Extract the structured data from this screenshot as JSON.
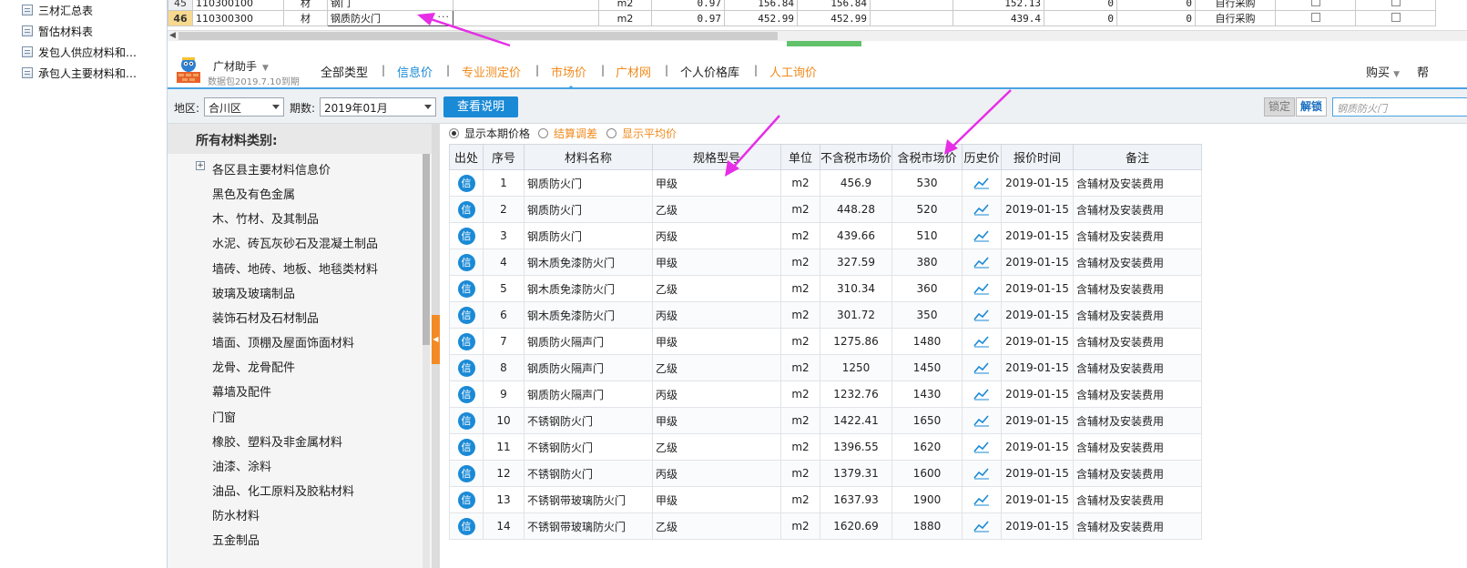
{
  "left_tree": {
    "items": [
      "三材汇总表",
      "暂估材料表",
      "发包人供应材料和…",
      "承包人主要材料和…"
    ]
  },
  "top_grid": {
    "rows": [
      {
        "num": "45",
        "code": "110300100",
        "type": "材",
        "name": "钢门",
        "unit": "m2",
        "coef": "0.97",
        "p1": "156.84",
        "p2": "156.84",
        "p3": "152.13",
        "v1": "0",
        "v2": "0",
        "purchase": "自行采购"
      },
      {
        "num": "46",
        "code": "110300300",
        "type": "材",
        "name": "钢质防火门",
        "unit": "m2",
        "coef": "0.97",
        "p1": "452.99",
        "p2": "452.99",
        "p3": "439.4",
        "v1": "0",
        "v2": "0",
        "purchase": "自行采购"
      }
    ],
    "ellipsis": "···"
  },
  "toolbar": {
    "brand": "广材助手",
    "brand_sub": "数据包2019.7.10到期",
    "tabs": [
      "全部类型",
      "信息价",
      "专业测定价",
      "市场价",
      "广材网",
      "个人价格库",
      "人工询价"
    ],
    "active_tab": "信息价",
    "buy": "购买",
    "help": "帮"
  },
  "filter": {
    "region_label": "地区:",
    "region_value": "合川区",
    "period_label": "期数:",
    "period_value": "2019年01月",
    "explain_button": "查看说明",
    "lock_button": "锁定",
    "unlock_button": "解锁",
    "search_value": "钢质防火门"
  },
  "categories": {
    "header": "所有材料类别:",
    "expander": "+",
    "items": [
      "各区县主要材料信息价",
      "黑色及有色金属",
      "木、竹材、及其制品",
      "水泥、砖瓦灰砂石及混凝土制品",
      "墙砖、地砖、地板、地毯类材料",
      "玻璃及玻璃制品",
      "装饰石材及石材制品",
      "墙面、顶棚及屋面饰面材料",
      "龙骨、龙骨配件",
      "幕墙及配件",
      "门窗",
      "橡胶、塑料及非金属材料",
      "油漆、涂料",
      "油品、化工原料及胶粘材料",
      "防水材料",
      "五金制品"
    ]
  },
  "options": {
    "show_current": "显示本期价格",
    "settlement": "结算调差",
    "show_average": "显示平均价"
  },
  "price_table": {
    "headers": [
      "出处",
      "序号",
      "材料名称",
      "规格型号",
      "单位",
      "不含税市场价",
      "含税市场价",
      "历史价",
      "报价时间",
      "备注"
    ],
    "source_badge": "信",
    "rows": [
      {
        "seq": "1",
        "name": "钢质防火门",
        "spec": "甲级",
        "unit": "m2",
        "ex_tax": "456.9",
        "inc_tax": "530",
        "date": "2019-01-15",
        "note": "含辅材及安装费用"
      },
      {
        "seq": "2",
        "name": "钢质防火门",
        "spec": "乙级",
        "unit": "m2",
        "ex_tax": "448.28",
        "inc_tax": "520",
        "date": "2019-01-15",
        "note": "含辅材及安装费用"
      },
      {
        "seq": "3",
        "name": "钢质防火门",
        "spec": "丙级",
        "unit": "m2",
        "ex_tax": "439.66",
        "inc_tax": "510",
        "date": "2019-01-15",
        "note": "含辅材及安装费用"
      },
      {
        "seq": "4",
        "name": "钢木质免漆防火门",
        "spec": "甲级",
        "unit": "m2",
        "ex_tax": "327.59",
        "inc_tax": "380",
        "date": "2019-01-15",
        "note": "含辅材及安装费用"
      },
      {
        "seq": "5",
        "name": "钢木质免漆防火门",
        "spec": "乙级",
        "unit": "m2",
        "ex_tax": "310.34",
        "inc_tax": "360",
        "date": "2019-01-15",
        "note": "含辅材及安装费用"
      },
      {
        "seq": "6",
        "name": "钢木质免漆防火门",
        "spec": "丙级",
        "unit": "m2",
        "ex_tax": "301.72",
        "inc_tax": "350",
        "date": "2019-01-15",
        "note": "含辅材及安装费用"
      },
      {
        "seq": "7",
        "name": "钢质防火隔声门",
        "spec": "甲级",
        "unit": "m2",
        "ex_tax": "1275.86",
        "inc_tax": "1480",
        "date": "2019-01-15",
        "note": "含辅材及安装费用"
      },
      {
        "seq": "8",
        "name": "钢质防火隔声门",
        "spec": "乙级",
        "unit": "m2",
        "ex_tax": "1250",
        "inc_tax": "1450",
        "date": "2019-01-15",
        "note": "含辅材及安装费用"
      },
      {
        "seq": "9",
        "name": "钢质防火隔声门",
        "spec": "丙级",
        "unit": "m2",
        "ex_tax": "1232.76",
        "inc_tax": "1430",
        "date": "2019-01-15",
        "note": "含辅材及安装费用"
      },
      {
        "seq": "10",
        "name": "不锈钢防火门",
        "spec": "甲级",
        "unit": "m2",
        "ex_tax": "1422.41",
        "inc_tax": "1650",
        "date": "2019-01-15",
        "note": "含辅材及安装费用"
      },
      {
        "seq": "11",
        "name": "不锈钢防火门",
        "spec": "乙级",
        "unit": "m2",
        "ex_tax": "1396.55",
        "inc_tax": "1620",
        "date": "2019-01-15",
        "note": "含辅材及安装费用"
      },
      {
        "seq": "12",
        "name": "不锈钢防火门",
        "spec": "丙级",
        "unit": "m2",
        "ex_tax": "1379.31",
        "inc_tax": "1600",
        "date": "2019-01-15",
        "note": "含辅材及安装费用"
      },
      {
        "seq": "13",
        "name": "不锈钢带玻璃防火门",
        "spec": "甲级",
        "unit": "m2",
        "ex_tax": "1637.93",
        "inc_tax": "1900",
        "date": "2019-01-15",
        "note": "含辅材及安装费用"
      },
      {
        "seq": "14",
        "name": "不锈钢带玻璃防火门",
        "spec": "乙级",
        "unit": "m2",
        "ex_tax": "1620.69",
        "inc_tax": "1880",
        "date": "2019-01-15",
        "note": "含辅材及安装费用"
      }
    ]
  },
  "colors": {
    "accent_blue": "#1a8ad6",
    "orange": "#f08a1c",
    "annotation_arrow": "#e62ee6"
  }
}
